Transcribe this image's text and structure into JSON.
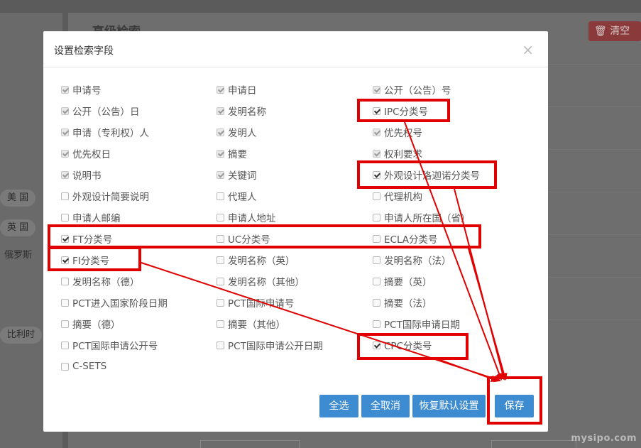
{
  "background": {
    "title": "高级检索",
    "clear_label": "清空",
    "chips": [
      "美 国",
      "英 国",
      "俄罗斯",
      "比利时"
    ]
  },
  "modal": {
    "title": "设置检索字段",
    "close_symbol": "×",
    "fields": [
      {
        "label": "申请号",
        "checked": true,
        "disabled": true
      },
      {
        "label": "申请日",
        "checked": true,
        "disabled": true
      },
      {
        "label": "公开（公告）号",
        "checked": true,
        "disabled": true
      },
      {
        "label": "公开（公告）日",
        "checked": true,
        "disabled": true
      },
      {
        "label": "发明名称",
        "checked": true,
        "disabled": true
      },
      {
        "label": "IPC分类号",
        "checked": true,
        "disabled": false
      },
      {
        "label": "申请（专利权）人",
        "checked": true,
        "disabled": true
      },
      {
        "label": "发明人",
        "checked": true,
        "disabled": true
      },
      {
        "label": "优先权号",
        "checked": true,
        "disabled": true
      },
      {
        "label": "优先权日",
        "checked": true,
        "disabled": true
      },
      {
        "label": "摘要",
        "checked": true,
        "disabled": true
      },
      {
        "label": "权利要求",
        "checked": true,
        "disabled": true
      },
      {
        "label": "说明书",
        "checked": true,
        "disabled": true
      },
      {
        "label": "关键词",
        "checked": true,
        "disabled": true
      },
      {
        "label": "外观设计洛迦诺分类号",
        "checked": true,
        "disabled": false
      },
      {
        "label": "外观设计简要说明",
        "checked": false,
        "disabled": false
      },
      {
        "label": "代理人",
        "checked": false,
        "disabled": false
      },
      {
        "label": "代理机构",
        "checked": false,
        "disabled": false
      },
      {
        "label": "申请人邮编",
        "checked": false,
        "disabled": false
      },
      {
        "label": "申请人地址",
        "checked": false,
        "disabled": false
      },
      {
        "label": "申请人所在国（省）",
        "checked": false,
        "disabled": false
      },
      {
        "label": "FT分类号",
        "checked": true,
        "disabled": false
      },
      {
        "label": "UC分类号",
        "checked": false,
        "disabled": false
      },
      {
        "label": "ECLA分类号",
        "checked": false,
        "disabled": false
      },
      {
        "label": "FI分类号",
        "checked": true,
        "disabled": false
      },
      {
        "label": "发明名称（英）",
        "checked": false,
        "disabled": false
      },
      {
        "label": "发明名称（法）",
        "checked": false,
        "disabled": false
      },
      {
        "label": "发明名称（德）",
        "checked": false,
        "disabled": false
      },
      {
        "label": "发明名称（其他）",
        "checked": false,
        "disabled": false
      },
      {
        "label": "摘要（英）",
        "checked": false,
        "disabled": false
      },
      {
        "label": "PCT进入国家阶段日期",
        "checked": false,
        "disabled": false
      },
      {
        "label": "PCT国际申请号",
        "checked": false,
        "disabled": false
      },
      {
        "label": "摘要（法）",
        "checked": false,
        "disabled": false
      },
      {
        "label": "摘要（德）",
        "checked": false,
        "disabled": false
      },
      {
        "label": "摘要（其他）",
        "checked": false,
        "disabled": false
      },
      {
        "label": "PCT国际申请日期",
        "checked": false,
        "disabled": false
      },
      {
        "label": "PCT国际申请公开号",
        "checked": false,
        "disabled": false
      },
      {
        "label": "PCT国际申请公开日期",
        "checked": false,
        "disabled": false
      },
      {
        "label": "CPC分类号",
        "checked": true,
        "disabled": false
      },
      {
        "label": "C-SETS",
        "checked": false,
        "disabled": false
      }
    ],
    "buttons": {
      "select_all": "全选",
      "deselect_all": "全取消",
      "restore_default": "恢复默认设置",
      "save": "保存"
    }
  },
  "watermark": "mysipo.com",
  "colors": {
    "primary_button": "#3d8bd0",
    "annotation": "#e00000"
  }
}
